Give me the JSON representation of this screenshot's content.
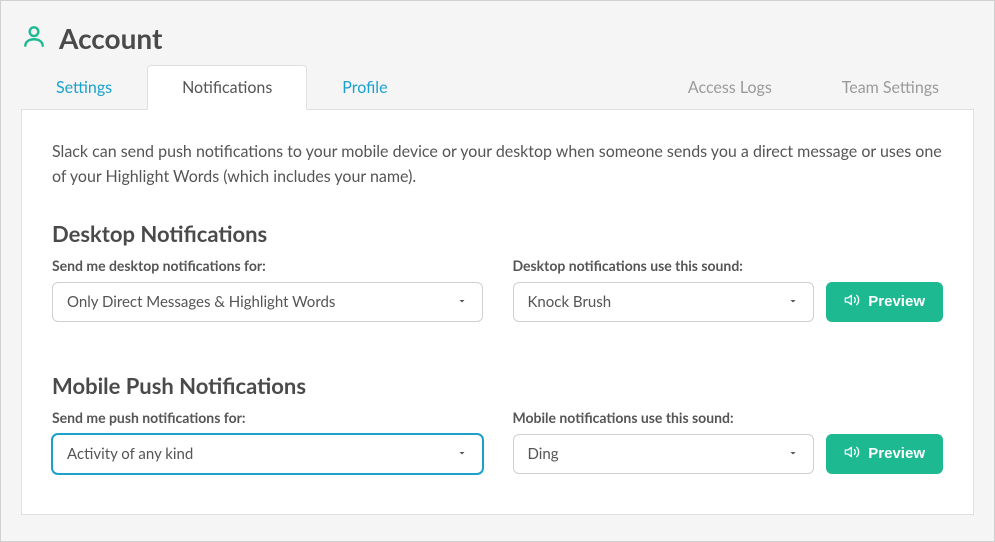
{
  "header": {
    "title": "Account"
  },
  "tabs": {
    "settings": "Settings",
    "notifications": "Notifications",
    "profile": "Profile",
    "access_logs": "Access Logs",
    "team_settings": "Team Settings"
  },
  "intro": "Slack can send push notifications to your mobile device or your desktop when someone sends you a direct message or uses one of your Highlight Words (which includes your name).",
  "desktop": {
    "heading": "Desktop Notifications",
    "for_label": "Send me desktop notifications for:",
    "for_value": "Only Direct Messages & Highlight Words",
    "sound_label": "Desktop notifications use this sound:",
    "sound_value": "Knock Brush",
    "preview_label": "Preview"
  },
  "mobile": {
    "heading": "Mobile Push Notifications",
    "for_label": "Send me push notifications for:",
    "for_value": "Activity of any kind",
    "sound_label": "Mobile notifications use this sound:",
    "sound_value": "Ding",
    "preview_label": "Preview"
  }
}
